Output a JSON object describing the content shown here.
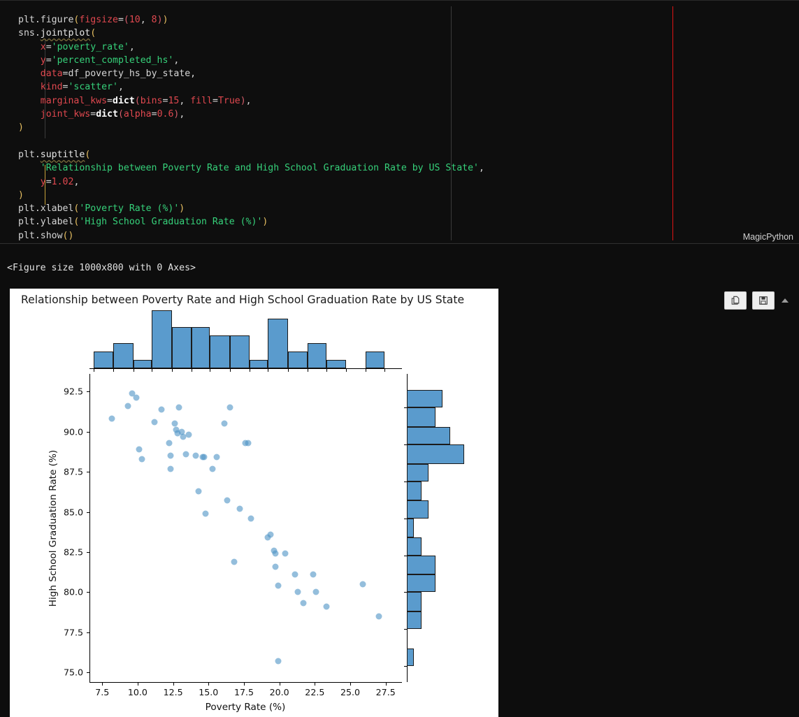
{
  "editor": {
    "language_mode": "MagicPython",
    "lines": [
      "plt.figure(figsize=(10, 8))",
      "sns.jointplot(",
      "    x='poverty_rate',",
      "    y='percent_completed_hs',",
      "    data=df_poverty_hs_by_state,",
      "    kind='scatter',",
      "    marginal_kws=dict(bins=15, fill=True),",
      "    joint_kws=dict(alpha=0.6),",
      ")",
      "",
      "plt.suptitle(",
      "    'Relationship between Poverty Rate and High School Graduation Rate by US State',",
      "    y=1.02,",
      ")",
      "plt.xlabel('Poverty Rate (%)')",
      "plt.ylabel('High School Graduation Rate (%)')",
      "plt.show()"
    ]
  },
  "output": {
    "stdout_text": "<Figure size 1000x800 with 0 Axes>"
  },
  "toolbar": {
    "copy_label": "copy-icon",
    "save_label": "save-icon",
    "collapse_label": "chevron-up-icon"
  },
  "chart_data": {
    "type": "scatter",
    "title": "Relationship between Poverty Rate and High School Graduation Rate by US State",
    "xlabel": "Poverty Rate (%)",
    "ylabel": "High School Graduation Rate (%)",
    "xlim": [
      6.6,
      28.6
    ],
    "ylim": [
      74.4,
      93.6
    ],
    "xticks": [
      "7.5",
      "10.0",
      "12.5",
      "15.0",
      "17.5",
      "20.0",
      "22.5",
      "25.0",
      "27.5"
    ],
    "xtickvals": [
      7.5,
      10.0,
      12.5,
      15.0,
      17.5,
      20.0,
      22.5,
      25.0,
      27.5
    ],
    "yticks": [
      "75.0",
      "77.5",
      "80.0",
      "82.5",
      "85.0",
      "87.5",
      "90.0",
      "92.5"
    ],
    "ytickvals": [
      75.0,
      77.5,
      80.0,
      82.5,
      85.0,
      87.5,
      90.0,
      92.5
    ],
    "grid": false,
    "legend": false,
    "marker_color": "#4d93c4",
    "marker_alpha": 0.6,
    "bar_color": "#5a9bcd",
    "bar_edge_color": "#1b1b1b",
    "points": [
      [
        8.2,
        90.8
      ],
      [
        9.3,
        91.6
      ],
      [
        9.6,
        92.4
      ],
      [
        9.9,
        92.1
      ],
      [
        10.1,
        88.9
      ],
      [
        10.3,
        88.3
      ],
      [
        11.2,
        90.6
      ],
      [
        11.7,
        91.4
      ],
      [
        12.2,
        89.3
      ],
      [
        12.3,
        88.5
      ],
      [
        12.3,
        87.7
      ],
      [
        12.6,
        90.5
      ],
      [
        12.7,
        90.1
      ],
      [
        12.8,
        89.9
      ],
      [
        12.9,
        91.5
      ],
      [
        13.1,
        90.0
      ],
      [
        13.2,
        89.7
      ],
      [
        13.4,
        88.6
      ],
      [
        13.6,
        89.8
      ],
      [
        14.1,
        88.5
      ],
      [
        14.3,
        86.3
      ],
      [
        14.6,
        88.4
      ],
      [
        14.7,
        88.4
      ],
      [
        14.8,
        84.9
      ],
      [
        15.3,
        87.7
      ],
      [
        15.6,
        88.4
      ],
      [
        16.1,
        90.5
      ],
      [
        16.3,
        85.7
      ],
      [
        16.5,
        91.5
      ],
      [
        16.8,
        81.9
      ],
      [
        17.2,
        85.2
      ],
      [
        17.6,
        89.3
      ],
      [
        17.8,
        89.3
      ],
      [
        18.0,
        84.6
      ],
      [
        19.2,
        83.4
      ],
      [
        19.4,
        83.6
      ],
      [
        19.6,
        82.6
      ],
      [
        19.7,
        82.4
      ],
      [
        19.7,
        81.6
      ],
      [
        19.9,
        80.4
      ],
      [
        19.9,
        75.7
      ],
      [
        20.4,
        82.4
      ],
      [
        21.1,
        81.1
      ],
      [
        21.3,
        80.0
      ],
      [
        21.7,
        79.3
      ],
      [
        22.4,
        81.1
      ],
      [
        22.6,
        80.0
      ],
      [
        23.3,
        79.1
      ],
      [
        25.9,
        80.5
      ],
      [
        27.0,
        78.5
      ]
    ],
    "top_histogram": {
      "orientation": "vertical",
      "bins": 15,
      "bin_edges": [
        6.9,
        8.3,
        9.7,
        11.0,
        12.4,
        13.8,
        15.1,
        16.5,
        17.9,
        19.2,
        20.6,
        22.0,
        23.3,
        24.7,
        26.1,
        27.4
      ],
      "counts": [
        2,
        3,
        1,
        7,
        5,
        5,
        4,
        4,
        1,
        6,
        2,
        3,
        1,
        0,
        2
      ],
      "ymax": 7
    },
    "right_histogram": {
      "orientation": "horizontal",
      "bins": 15,
      "bin_edges": [
        75.4,
        76.5,
        77.7,
        78.8,
        80.0,
        81.1,
        82.3,
        83.4,
        84.6,
        85.7,
        86.9,
        88.0,
        89.2,
        90.3,
        91.5,
        92.6
      ],
      "counts": [
        1,
        0,
        2,
        2,
        4,
        4,
        2,
        1,
        3,
        2,
        3,
        8,
        6,
        4,
        5
      ],
      "xmax": 8
    }
  }
}
